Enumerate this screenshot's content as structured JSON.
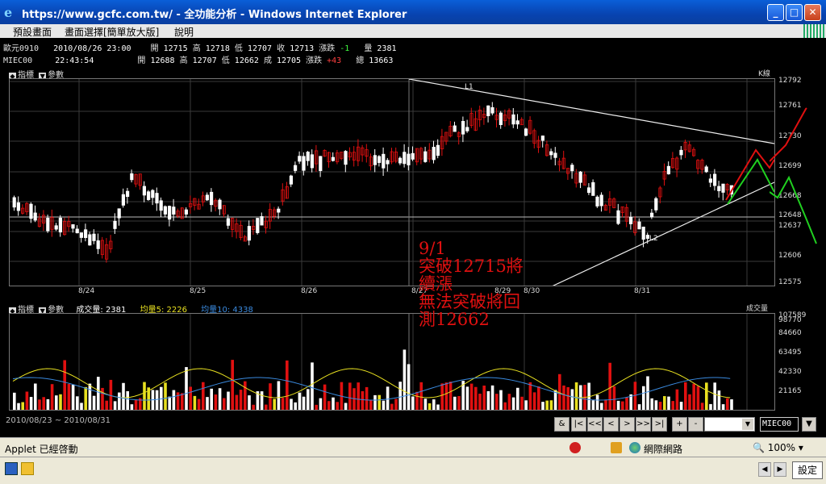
{
  "window": {
    "title": "https://www.gcfc.com.tw/ - 全功能分析 - Windows Internet Explorer",
    "minimize_icon": "minimize-icon",
    "maximize_icon": "maximize-icon",
    "close_icon": "close-icon"
  },
  "menu": {
    "items": [
      "預設畫面",
      "畫面選擇[簡單放大版]",
      "說明"
    ]
  },
  "quotes": [
    {
      "symbol": "歐元0910",
      "datetime": "2010/08/26 23:00",
      "open_lbl": "開",
      "open": "12715",
      "high_lbl": "高",
      "high": "12718",
      "low_lbl": "低",
      "low": "12707",
      "close_lbl": "收",
      "close": "12713",
      "chg_lbl": "漲跌",
      "chg": "-1",
      "vol_lbl": "量",
      "vol": "2381"
    },
    {
      "symbol": "MIEC00",
      "datetime": "22:43:54",
      "open_lbl": "開",
      "open": "12688",
      "high_lbl": "高",
      "high": "12707",
      "low_lbl": "低",
      "low": "12662",
      "close_lbl": "成",
      "close": "12705",
      "chg_lbl": "漲跌",
      "chg": "+43",
      "vol_lbl": "總",
      "vol": "13663"
    }
  ],
  "price_panel": {
    "indicator_lbl": "指標",
    "param_lbl": "參數",
    "chart_type_lbl": "K線",
    "yticks": [
      "12792",
      "12761",
      "12730",
      "12699",
      "12668",
      "12648",
      "12637",
      "12606",
      "12575"
    ],
    "xticks": [
      "8/24",
      "8/25",
      "8/26",
      "8/27",
      "8/29",
      "8/30",
      "8/31"
    ],
    "markers": [
      "L1",
      "L2"
    ]
  },
  "volume_panel": {
    "indicator_lbl": "指標",
    "param_lbl": "參數",
    "vol_lbl": "成交量:",
    "vol_val": "2381",
    "ma5_lbl": "均量5:",
    "ma5_val": "2226",
    "ma10_lbl": "均量10:",
    "ma10_val": "4338",
    "right_lbl": "成交量",
    "yticks": [
      "107589",
      "98770",
      "84660",
      "63495",
      "42330",
      "21165"
    ]
  },
  "annotation": [
    "9/1",
    "突破12715將",
    "續漲",
    "無法突破將回",
    "測12662"
  ],
  "date_range": "2010/08/23 ~ 2010/08/31",
  "nav_buttons": [
    "&",
    "|<",
    "<<",
    "<",
    ">",
    ">>",
    ">|",
    "+",
    "-"
  ],
  "symbol_box": "MIEC00",
  "status": {
    "text": "Applet 已經啓動",
    "zone": "網際網路",
    "zoom": "100%"
  },
  "taskbar": {
    "settings": "設定"
  },
  "colors": {
    "up": "#e01010",
    "down": "#ffffff",
    "ma5": "#e8e020",
    "ma10": "#3a8adf",
    "forecast_up": "#e01010",
    "forecast_down": "#20d020"
  }
}
